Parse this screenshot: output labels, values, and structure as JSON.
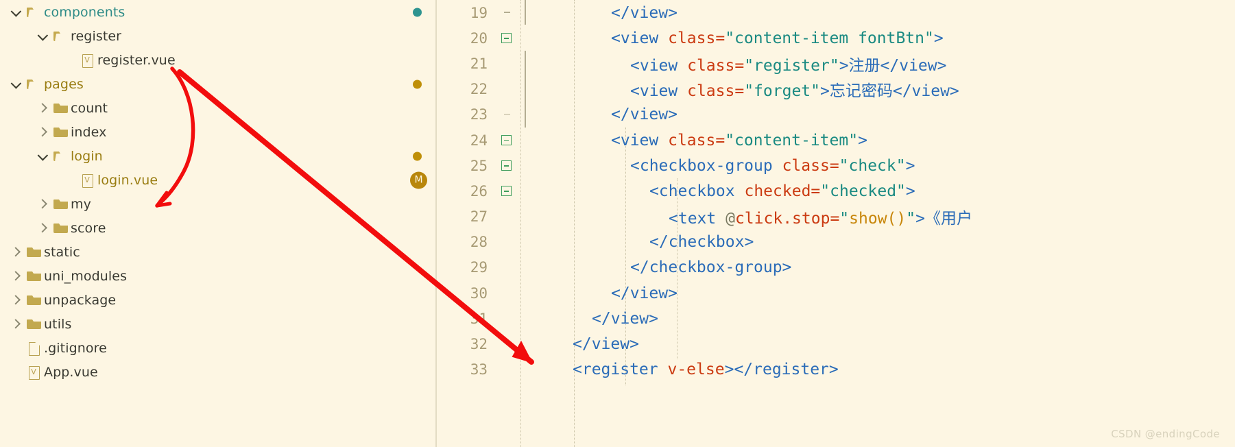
{
  "theme": {
    "background": "#fdf6e3",
    "tag_color": "#2b6cb8",
    "attribute_color": "#cb3b12",
    "string_color": "#1a8a82",
    "function_color": "#c8860a",
    "lineno_color": "#a79a74",
    "fold_marker_color": "#3f9d5c",
    "annotation_color": "#f20d0d",
    "status_teal": "#2e9490",
    "status_gold": "#bf8f08"
  },
  "file_tree": {
    "items": [
      {
        "label": "components",
        "depth": 0,
        "twisty": "down",
        "icon": "folder-open",
        "label_color": "teal",
        "status": "teal"
      },
      {
        "label": "register",
        "depth": 1,
        "twisty": "down",
        "icon": "folder-open",
        "label_color": "dark",
        "status": "none"
      },
      {
        "label": "register.vue",
        "depth": 2,
        "twisty": "blank",
        "icon": "vue",
        "label_color": "dark",
        "status": "none"
      },
      {
        "label": "pages",
        "depth": 0,
        "twisty": "down",
        "icon": "folder-open",
        "label_color": "gold",
        "status": "gold"
      },
      {
        "label": "count",
        "depth": 1,
        "twisty": "right",
        "icon": "folder",
        "label_color": "dark",
        "status": "none"
      },
      {
        "label": "index",
        "depth": 1,
        "twisty": "right",
        "icon": "folder",
        "label_color": "dark",
        "status": "none"
      },
      {
        "label": "login",
        "depth": 1,
        "twisty": "down",
        "icon": "folder-open",
        "label_color": "gold",
        "status": "gold"
      },
      {
        "label": "login.vue",
        "depth": 2,
        "twisty": "blank",
        "icon": "vue",
        "label_color": "gold",
        "status": "badge-m"
      },
      {
        "label": "my",
        "depth": 1,
        "twisty": "right",
        "icon": "folder",
        "label_color": "dark",
        "status": "none"
      },
      {
        "label": "score",
        "depth": 1,
        "twisty": "right",
        "icon": "folder",
        "label_color": "dark",
        "status": "none"
      },
      {
        "label": "static",
        "depth": 0,
        "twisty": "right",
        "icon": "folder",
        "label_color": "dark",
        "status": "none"
      },
      {
        "label": "uni_modules",
        "depth": 0,
        "twisty": "right",
        "icon": "folder",
        "label_color": "dark",
        "status": "none"
      },
      {
        "label": "unpackage",
        "depth": 0,
        "twisty": "right",
        "icon": "folder",
        "label_color": "dark",
        "status": "none"
      },
      {
        "label": "utils",
        "depth": 0,
        "twisty": "right",
        "icon": "folder",
        "label_color": "dark",
        "status": "none"
      },
      {
        "label": ".gitignore",
        "depth": 0,
        "twisty": "blank",
        "icon": "file",
        "label_color": "dark",
        "status": "none"
      },
      {
        "label": "App.vue",
        "depth": 0,
        "twisty": "blank",
        "icon": "vue",
        "label_color": "dark",
        "status": "none"
      }
    ],
    "status_badge_label": "M"
  },
  "editor": {
    "lines": [
      {
        "no": "19",
        "fold": "tick",
        "indent": 6,
        "tokens": [
          {
            "t": "tag",
            "v": "</view>"
          }
        ]
      },
      {
        "no": "20",
        "fold": "minus",
        "indent": 6,
        "tokens": [
          {
            "t": "tag",
            "v": "<view "
          },
          {
            "t": "attr",
            "v": "class"
          },
          {
            "t": "eq",
            "v": "="
          },
          {
            "t": "str",
            "v": "\"content-item fontBtn\""
          },
          {
            "t": "tag",
            "v": ">"
          }
        ]
      },
      {
        "no": "21",
        "fold": "none",
        "indent": 8,
        "tokens": [
          {
            "t": "tag",
            "v": "<view "
          },
          {
            "t": "attr",
            "v": "class"
          },
          {
            "t": "eq",
            "v": "="
          },
          {
            "t": "str",
            "v": "\"register\""
          },
          {
            "t": "tag",
            "v": ">"
          },
          {
            "t": "cjk",
            "v": "注册"
          },
          {
            "t": "tag",
            "v": "</view>"
          }
        ]
      },
      {
        "no": "22",
        "fold": "none",
        "indent": 8,
        "tokens": [
          {
            "t": "tag",
            "v": "<view "
          },
          {
            "t": "attr",
            "v": "class"
          },
          {
            "t": "eq",
            "v": "="
          },
          {
            "t": "str",
            "v": "\"forget\""
          },
          {
            "t": "tag",
            "v": ">"
          },
          {
            "t": "cjk",
            "v": "忘记密码"
          },
          {
            "t": "tag",
            "v": "</view>"
          }
        ]
      },
      {
        "no": "23",
        "fold": "tick",
        "indent": 6,
        "tokens": [
          {
            "t": "tag",
            "v": "</view>"
          }
        ]
      },
      {
        "no": "24",
        "fold": "minus",
        "indent": 6,
        "tokens": [
          {
            "t": "tag",
            "v": "<view "
          },
          {
            "t": "attr",
            "v": "class"
          },
          {
            "t": "eq",
            "v": "="
          },
          {
            "t": "str",
            "v": "\"content-item\""
          },
          {
            "t": "tag",
            "v": ">"
          }
        ]
      },
      {
        "no": "25",
        "fold": "minus",
        "indent": 8,
        "tokens": [
          {
            "t": "tag",
            "v": "<checkbox-group "
          },
          {
            "t": "attr",
            "v": "class"
          },
          {
            "t": "eq",
            "v": "="
          },
          {
            "t": "str",
            "v": "\"check\""
          },
          {
            "t": "tag",
            "v": ">"
          }
        ]
      },
      {
        "no": "26",
        "fold": "minus",
        "indent": 10,
        "tokens": [
          {
            "t": "tag",
            "v": "<checkbox "
          },
          {
            "t": "attr",
            "v": "checked"
          },
          {
            "t": "eq",
            "v": "="
          },
          {
            "t": "str",
            "v": "\"checked\""
          },
          {
            "t": "tag",
            "v": ">"
          }
        ]
      },
      {
        "no": "27",
        "fold": "none",
        "indent": 12,
        "tokens": [
          {
            "t": "tag",
            "v": "<text "
          },
          {
            "t": "at",
            "v": "@"
          },
          {
            "t": "attr",
            "v": "click.stop"
          },
          {
            "t": "eq",
            "v": "="
          },
          {
            "t": "str",
            "v": "\""
          },
          {
            "t": "fn",
            "v": "show()"
          },
          {
            "t": "str",
            "v": "\""
          },
          {
            "t": "tag",
            "v": ">"
          },
          {
            "t": "cjk",
            "v": "《用户"
          }
        ]
      },
      {
        "no": "28",
        "fold": "none",
        "indent": 10,
        "tokens": [
          {
            "t": "tag",
            "v": "</checkbox>"
          }
        ]
      },
      {
        "no": "29",
        "fold": "none",
        "indent": 8,
        "tokens": [
          {
            "t": "tag",
            "v": "</checkbox-group>"
          }
        ]
      },
      {
        "no": "30",
        "fold": "none",
        "indent": 6,
        "tokens": [
          {
            "t": "tag",
            "v": "</view>"
          }
        ]
      },
      {
        "no": "31",
        "fold": "none",
        "indent": 4,
        "tokens": [
          {
            "t": "tag",
            "v": "</view>"
          }
        ]
      },
      {
        "no": "32",
        "fold": "none",
        "indent": 2,
        "tokens": [
          {
            "t": "tag",
            "v": "</view>"
          }
        ]
      },
      {
        "no": "33",
        "fold": "none",
        "indent": 2,
        "tokens": [
          {
            "t": "tag",
            "v": "<register "
          },
          {
            "t": "attr",
            "v": "v-else"
          },
          {
            "t": "tag",
            "v": "></register>"
          }
        ]
      }
    ]
  },
  "annotations": {
    "arrow_1_label": "curved-arrow-register-to-login",
    "arrow_2_label": "long-arrow-tree-to-register-tag"
  },
  "watermark": {
    "text": "CSDN @endingCode"
  }
}
